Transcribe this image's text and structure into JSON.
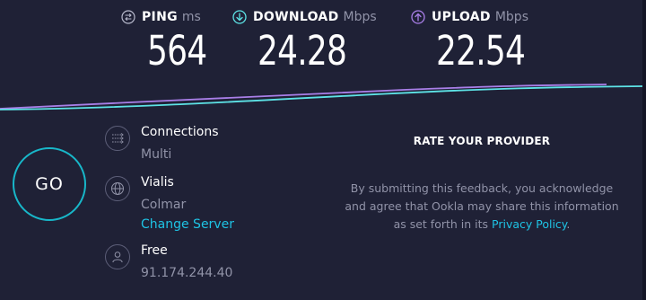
{
  "metrics": {
    "ping": {
      "name": "PING",
      "unit": "ms",
      "value": "564"
    },
    "download": {
      "name": "DOWNLOAD",
      "unit": "Mbps",
      "value": "24.28"
    },
    "upload": {
      "name": "UPLOAD",
      "unit": "Mbps",
      "value": "22.54"
    }
  },
  "go_button": {
    "label": "GO"
  },
  "connections": {
    "title": "Connections",
    "value": "Multi"
  },
  "server": {
    "name": "Vialis",
    "location": "Colmar",
    "change_label": "Change Server"
  },
  "isp": {
    "name": "Free",
    "ip": "91.174.244.40"
  },
  "rate": {
    "title": "RATE YOUR PROVIDER",
    "text_before": "By submitting this feedback, you acknowledge and agree that Ookla may share this information as set forth in its ",
    "link": "Privacy Policy",
    "text_after": "."
  },
  "colors": {
    "background": "#1f2136",
    "accent_cyan": "#1ec3e4",
    "upload_purple": "#a97fe8",
    "download_cyan": "#5de3e6",
    "muted_text": "#9193a8"
  },
  "icons": {
    "ping": "ping-icon",
    "download": "download-arrow-icon",
    "upload": "upload-arrow-icon",
    "connections": "connections-icon",
    "server": "globe-icon",
    "isp": "person-icon"
  }
}
